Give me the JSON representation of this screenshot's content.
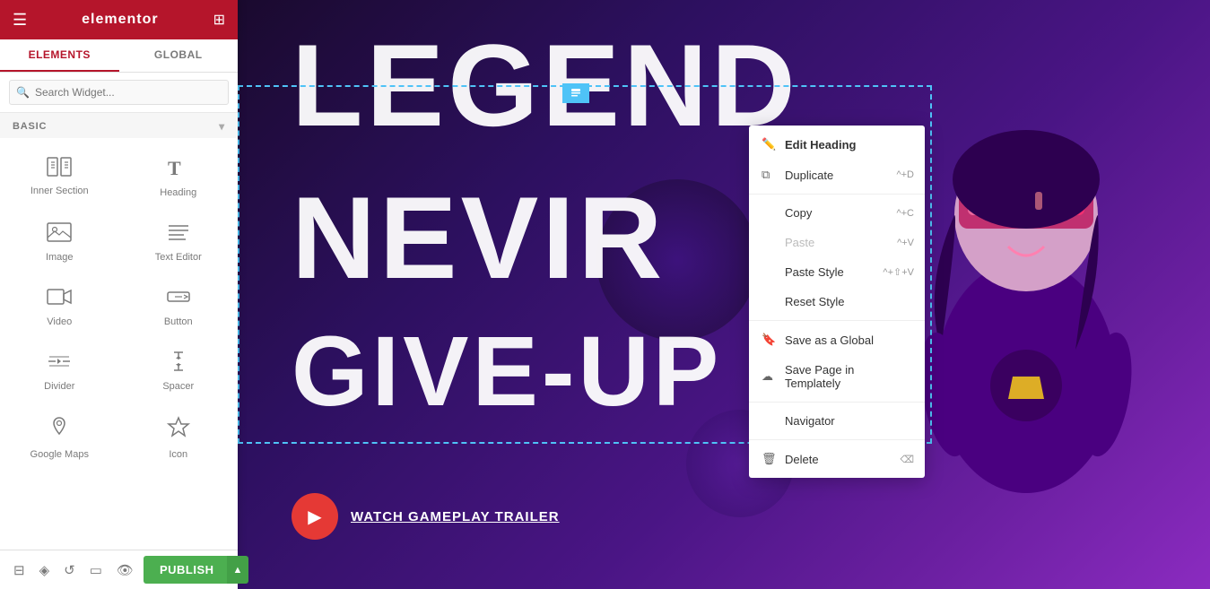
{
  "sidebar": {
    "header": {
      "logo": "elementor",
      "hamburger_icon": "☰",
      "grid_icon": "⊞"
    },
    "tabs": [
      {
        "id": "elements",
        "label": "ELEMENTS",
        "active": true
      },
      {
        "id": "global",
        "label": "GLOBAL",
        "active": false
      }
    ],
    "search": {
      "placeholder": "Search Widget..."
    },
    "basic_section": {
      "label": "BASIC",
      "collapsed": false
    },
    "widgets": [
      {
        "id": "inner-section",
        "label": "Inner Section",
        "icon": "inner_section"
      },
      {
        "id": "heading",
        "label": "Heading",
        "icon": "heading"
      },
      {
        "id": "image",
        "label": "Image",
        "icon": "image"
      },
      {
        "id": "text-editor",
        "label": "Text Editor",
        "icon": "text_editor"
      },
      {
        "id": "video",
        "label": "Video",
        "icon": "video"
      },
      {
        "id": "button",
        "label": "Button",
        "icon": "button"
      },
      {
        "id": "divider",
        "label": "Divider",
        "icon": "divider"
      },
      {
        "id": "spacer",
        "label": "Spacer",
        "icon": "spacer"
      },
      {
        "id": "google-maps",
        "label": "Google Maps",
        "icon": "google_maps"
      },
      {
        "id": "icon",
        "label": "Icon",
        "icon": "icon"
      }
    ]
  },
  "bottom_toolbar": {
    "icons": [
      "layers",
      "widgets",
      "history",
      "responsive",
      "preview"
    ],
    "publish_label": "PUBLISH",
    "publish_arrow": "▲"
  },
  "context_menu": {
    "items": [
      {
        "id": "edit-heading",
        "label": "Edit Heading",
        "shortcut": "",
        "icon": "pencil",
        "disabled": false
      },
      {
        "id": "duplicate",
        "label": "Duplicate",
        "shortcut": "^+D",
        "icon": "copy2",
        "disabled": false
      },
      {
        "id": "copy",
        "label": "Copy",
        "shortcut": "^+C",
        "icon": "",
        "disabled": false
      },
      {
        "id": "paste",
        "label": "Paste",
        "shortcut": "^+V",
        "icon": "",
        "disabled": true
      },
      {
        "id": "paste-style",
        "label": "Paste Style",
        "shortcut": "^+⇧+V",
        "icon": "",
        "disabled": false
      },
      {
        "id": "reset-style",
        "label": "Reset Style",
        "shortcut": "",
        "icon": "",
        "disabled": false
      },
      {
        "id": "save-global",
        "label": "Save as a Global",
        "shortcut": "",
        "icon": "bookmark",
        "disabled": false
      },
      {
        "id": "save-templately",
        "label": "Save Page in Templately",
        "shortcut": "",
        "icon": "cloud",
        "disabled": false
      },
      {
        "id": "navigator",
        "label": "Navigator",
        "shortcut": "",
        "icon": "",
        "disabled": false
      },
      {
        "id": "delete",
        "label": "Delete",
        "shortcut": "⌫",
        "icon": "trash",
        "disabled": false
      }
    ]
  },
  "canvas": {
    "text_legend": "LEGEND",
    "text_never": "NEVI",
    "text_giveup": "GIVE-UP",
    "watch_label": "WATCH GAMEPLAY TRAILER"
  }
}
